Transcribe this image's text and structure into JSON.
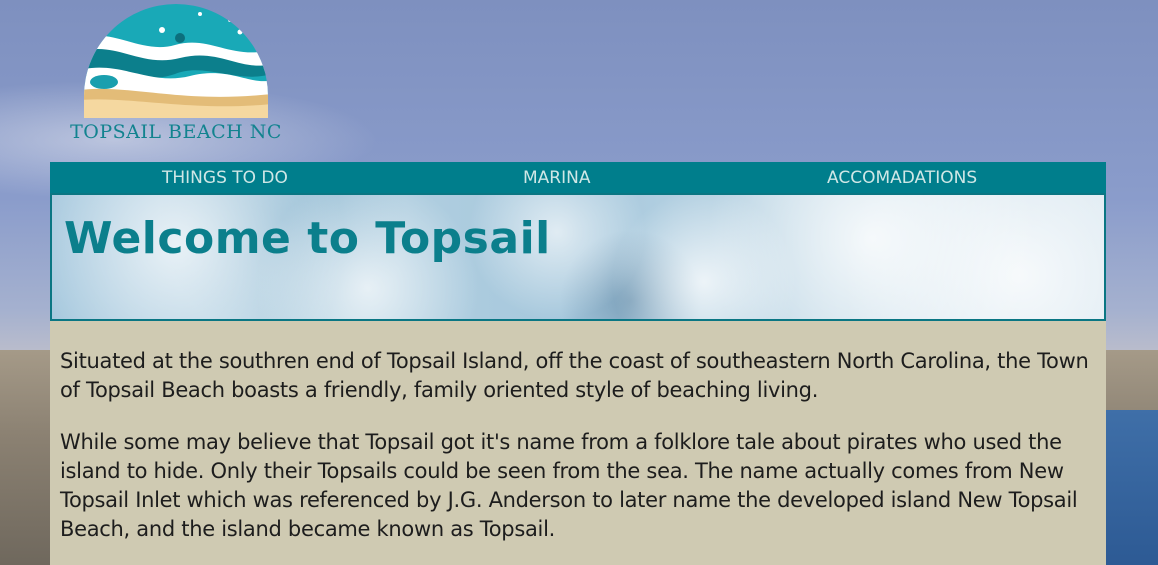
{
  "logo": {
    "text": "TOPSAIL BEACH NC",
    "icon": "beach-wave-logo-icon",
    "colors": {
      "teal": "#12838f",
      "sand": "#e8c07d",
      "wave": "#3fb5c1"
    }
  },
  "nav": {
    "items": [
      {
        "label": "THINGS TO DO"
      },
      {
        "label": "MARINA"
      },
      {
        "label": "ACCOMADATIONS"
      }
    ]
  },
  "hero": {
    "title": "Welcome to Topsail"
  },
  "content": {
    "paragraphs": [
      "Situated at the southren end of Topsail Island, off the coast of southeastern North Carolina, the Town of Topsail Beach boasts a friendly, family oriented style of beaching living.",
      "While some may believe that Topsail got it's name from a folklore tale about pirates who used the island to hide. Only their Topsails could be seen from the sea. The name actually comes from New Topsail Inlet which was referenced by J.G. Anderson to later name the developed island New Topsail Beach, and the island became known as Topsail."
    ]
  },
  "colors": {
    "nav_bg": "#007e8c",
    "nav_text": "#cfe7e6",
    "content_bg": "#cfcab2",
    "hero_title": "#0b7f8c"
  }
}
